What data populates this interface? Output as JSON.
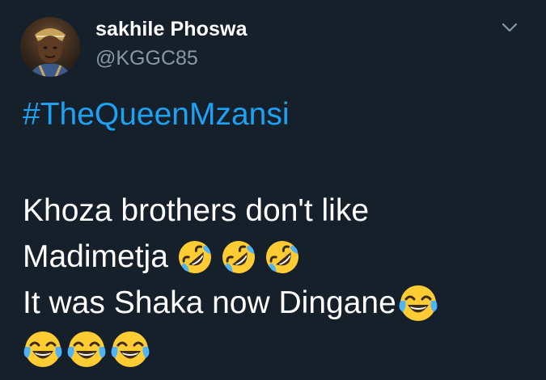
{
  "tweet": {
    "display_name": "sakhile Phoswa",
    "handle": "@KGGC85",
    "hashtag": "#TheQueenMzansi",
    "lines": [
      "Khoza brothers don't like",
      "Madimetja",
      "It was Shaka now Dingane",
      ""
    ]
  },
  "icons": {
    "menu": "chevron-down-icon",
    "rofl": "rolling-on-floor-laughing-emoji",
    "joy": "face-with-tears-of-joy-emoji"
  },
  "colors": {
    "background": "#15202b",
    "text": "#ffffff",
    "secondary_text": "#8899a6",
    "link": "#1da1f2",
    "emoji_yellow": "#ffcc33"
  }
}
